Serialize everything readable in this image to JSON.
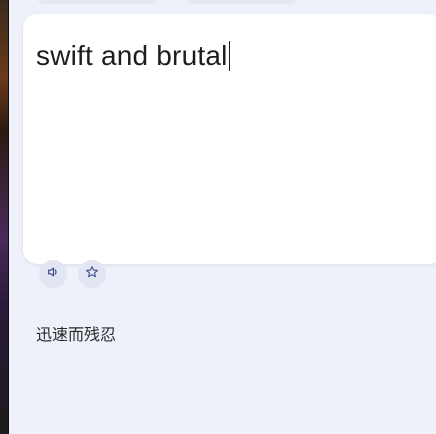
{
  "source": {
    "text": "swift and brutal"
  },
  "actions": {
    "speak_icon": "speaker-icon",
    "favorite_icon": "star-icon"
  },
  "result": {
    "text": "迅速而残忍"
  },
  "colors": {
    "background": "#eef1f9",
    "card": "#ffffff",
    "icon_button": "#e2e6f3",
    "icon": "#3b4a8a"
  }
}
